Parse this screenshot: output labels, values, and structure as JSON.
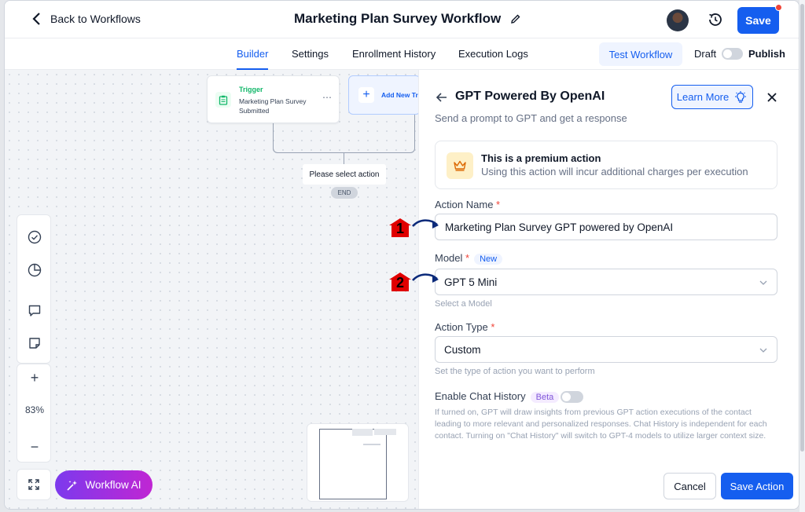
{
  "header": {
    "back_label": "Back to Workflows",
    "title": "Marketing Plan Survey Workflow",
    "save_label": "Save"
  },
  "tabs": {
    "items": [
      {
        "label": "Builder",
        "active": true
      },
      {
        "label": "Settings"
      },
      {
        "label": "Enrollment History"
      },
      {
        "label": "Execution Logs"
      }
    ],
    "test_label": "Test Workflow",
    "draft_label": "Draft",
    "publish_label": "Publish"
  },
  "canvas": {
    "trigger_label": "Trigger",
    "trigger_desc": "Marketing Plan Survey Submitted",
    "add_trigger_label": "Add New Tr",
    "select_action": "Please select action",
    "end_label": "END",
    "zoom": "83%",
    "ai_label": "Workflow AI"
  },
  "panel": {
    "title": "GPT Powered By OpenAI",
    "subtitle": "Send a prompt to GPT and get a response",
    "learn_more": "Learn More",
    "premium_title": "This is a premium action",
    "premium_desc": "Using this action will incur additional charges per execution",
    "action_name_label": "Action Name",
    "action_name_value": "Marketing Plan Survey GPT powered by OpenAI",
    "model_label": "Model",
    "model_badge": "New",
    "model_value": "GPT 5 Mini",
    "model_help": "Select a Model",
    "action_type_label": "Action Type",
    "action_type_value": "Custom",
    "action_type_help": "Set the type of action you want to perform",
    "chat_history_label": "Enable Chat History",
    "chat_history_badge": "Beta",
    "chat_history_desc": "If turned on, GPT will draw insights from previous GPT action executions of the contact leading to more relevant and personalized responses. Chat History is independent for each contact. Turning on \"Chat History\" will switch to GPT-4 models to utilize larger context size.",
    "cancel_label": "Cancel",
    "save_action_label": "Save Action",
    "required_mark": "*"
  },
  "annotations": {
    "marker_1": "1",
    "marker_2": "2"
  },
  "colors": {
    "accent": "#155eef",
    "ai_gradient_start": "#7c3aed",
    "ai_gradient_end": "#c026d3",
    "marker_red": "#e00000"
  }
}
